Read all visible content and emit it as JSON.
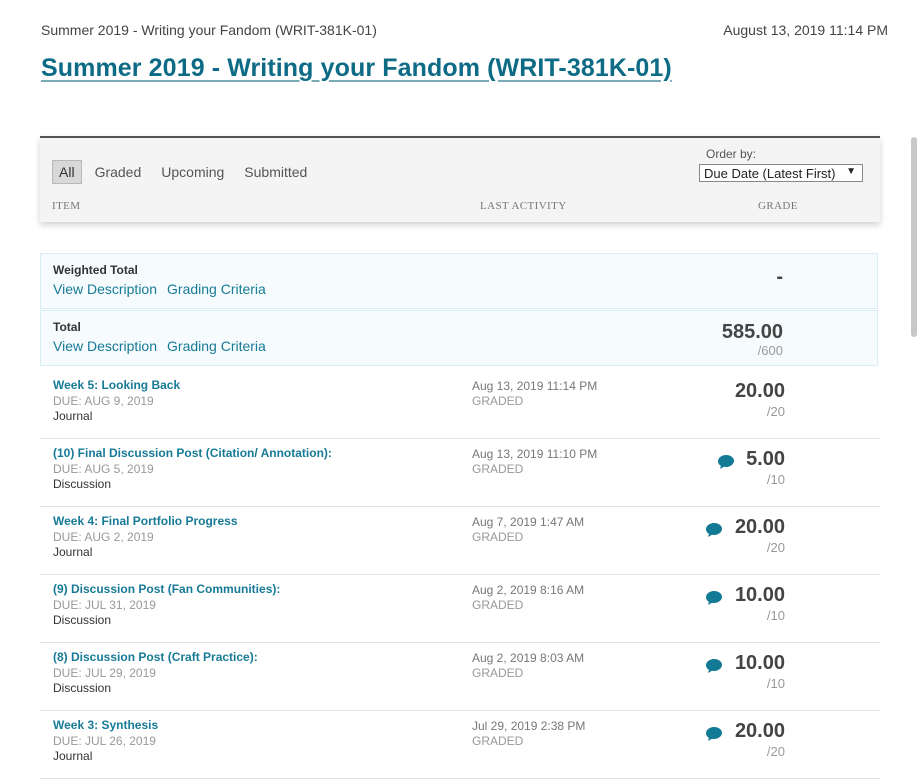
{
  "header": {
    "breadcrumb": "Summer 2019 - Writing your Fandom (WRIT-381K-01)",
    "datetime": "August 13, 2019 11:14 PM",
    "title": "Summer 2019 - Writing your Fandom (WRIT-381K-01)"
  },
  "filters": {
    "tabs": [
      {
        "label": "All",
        "active": true
      },
      {
        "label": "Graded"
      },
      {
        "label": "Upcoming"
      },
      {
        "label": "Submitted"
      }
    ],
    "order_label": "Order by:",
    "order_value": "Due Date (Latest First)",
    "caret": "▼"
  },
  "columns": {
    "item": "ITEM",
    "activity": "LAST ACTIVITY",
    "grade": "GRADE"
  },
  "summary": {
    "weighted": {
      "label": "Weighted Total",
      "link1": "View Description",
      "link2": "Grading Criteria",
      "grade": "-"
    },
    "total": {
      "label": "Total",
      "link1": "View Description",
      "link2": "Grading Criteria",
      "grade": "585.00",
      "max": "/600"
    }
  },
  "items": [
    {
      "title": "Week 5: Looking Back",
      "due": "DUE: AUG 9, 2019",
      "type": "Journal",
      "activity": "Aug 13, 2019 11:14 PM",
      "status": "GRADED",
      "score": "20.00",
      "outof": "/20",
      "comment": false
    },
    {
      "title": "(10) Final Discussion Post (Citation/ Annotation):",
      "due": "DUE: AUG 5, 2019",
      "type": "Discussion",
      "activity": "Aug 13, 2019 11:10 PM",
      "status": "GRADED",
      "score": "5.00",
      "outof": "/10",
      "comment": true
    },
    {
      "title": "Week 4: Final Portfolio Progress",
      "due": "DUE: AUG 2, 2019",
      "type": "Journal",
      "activity": "Aug 7, 2019 1:47 AM",
      "status": "GRADED",
      "score": "20.00",
      "outof": "/20",
      "comment": true
    },
    {
      "title": "(9) Discussion Post (Fan Communities):",
      "due": "DUE: JUL 31, 2019",
      "type": "Discussion",
      "activity": "Aug 2, 2019 8:16 AM",
      "status": "GRADED",
      "score": "10.00",
      "outof": "/10",
      "comment": true
    },
    {
      "title": "(8) Discussion Post (Craft Practice):",
      "due": "DUE: JUL 29, 2019",
      "type": "Discussion",
      "activity": "Aug 2, 2019 8:03 AM",
      "status": "GRADED",
      "score": "10.00",
      "outof": "/10",
      "comment": true
    },
    {
      "title": "Week 3: Synthesis",
      "due": "DUE: JUL 26, 2019",
      "type": "Journal",
      "activity": "Jul 29, 2019 2:38 PM",
      "status": "GRADED",
      "score": "20.00",
      "outof": "/20",
      "comment": true
    }
  ],
  "colors": {
    "accent": "#0d6b86",
    "link": "#177a96",
    "comment_icon": "#137a96"
  },
  "icons": {
    "comment": "speech-bubble-icon",
    "dropdown": "chevron-down-icon"
  }
}
